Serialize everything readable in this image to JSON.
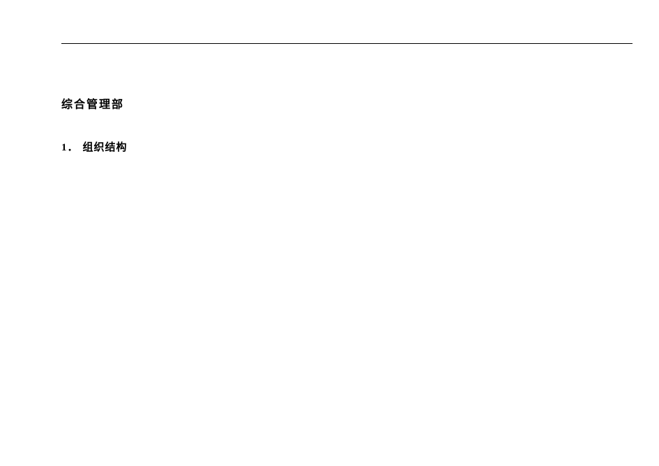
{
  "document": {
    "title": "综合管理部",
    "sections": [
      {
        "number": "1．",
        "heading": "组织结构"
      }
    ]
  }
}
